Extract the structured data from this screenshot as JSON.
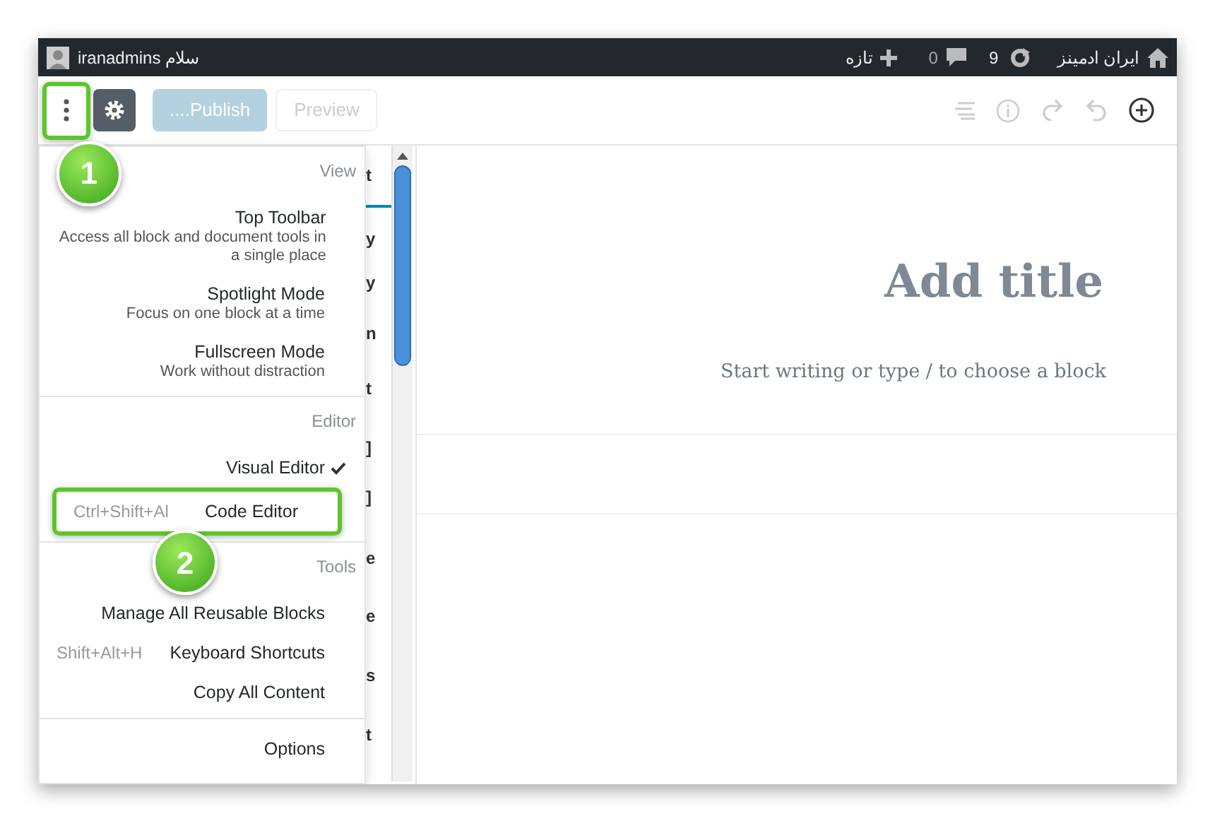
{
  "admin_bar": {
    "user": "iranadmins سلام",
    "new_label": "تازه",
    "comments_count": "0",
    "updates_count": "9",
    "site_name": "ایران ادمینز"
  },
  "toolbar": {
    "more_callout": "1",
    "publish_label": "....Publish",
    "preview_label": "Preview"
  },
  "menu": {
    "sections": [
      {
        "heading": "View",
        "items": [
          {
            "label": "Top Toolbar",
            "description": "Access all block and document tools in a single place",
            "checked": false
          },
          {
            "label": "Spotlight Mode",
            "description": "Focus on one block at a time",
            "checked": false
          },
          {
            "label": "Fullscreen Mode",
            "description": "Work without distraction",
            "checked": false
          }
        ]
      },
      {
        "heading": "Editor",
        "items": [
          {
            "label": "Visual Editor",
            "checked": true
          },
          {
            "label": "Code Editor",
            "shortcut": "Ctrl+Shift+Al",
            "checked": false,
            "callout": "2"
          }
        ]
      },
      {
        "heading": "Tools",
        "items": [
          {
            "label": "Manage All Reusable Blocks"
          },
          {
            "label": "Keyboard Shortcuts",
            "shortcut": "Shift+Alt+H"
          },
          {
            "label": "Copy All Content"
          }
        ]
      }
    ],
    "footer_item": "Options"
  },
  "sidebar_fragments": [
    "t",
    "y",
    "y",
    "n",
    "t",
    "]",
    "]",
    "e",
    "e",
    "s",
    "t"
  ],
  "editor": {
    "title_placeholder": "Add title",
    "body_placeholder": "Start writing or type / to choose a block"
  }
}
